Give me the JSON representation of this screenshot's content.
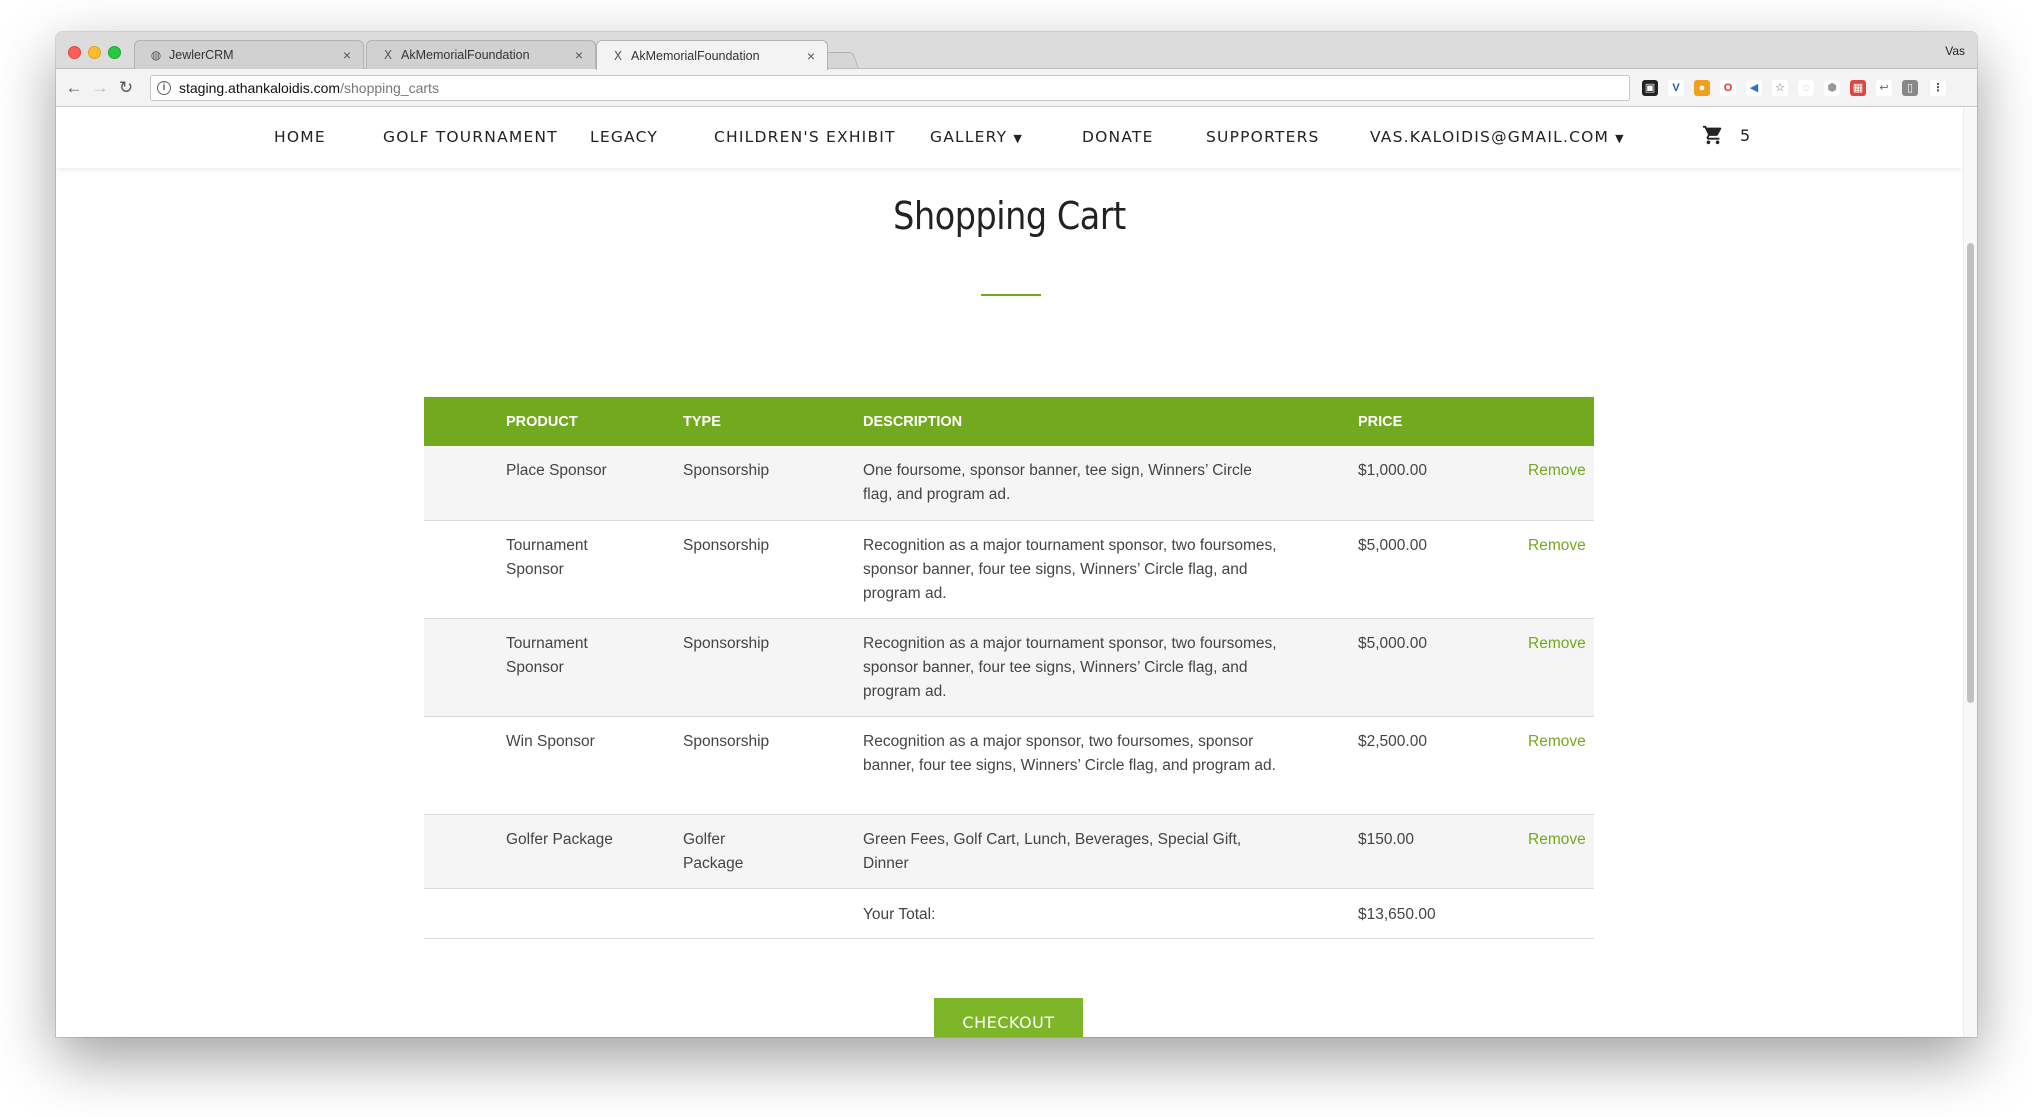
{
  "browser": {
    "tabs": [
      {
        "title": "JewlerCRM",
        "icon": "globe-icon",
        "active": false
      },
      {
        "title": "AkMemorialFoundation",
        "icon": "golf-clubs-icon",
        "active": false
      },
      {
        "title": "AkMemorialFoundation",
        "icon": "golf-clubs-icon",
        "active": true
      }
    ],
    "close_glyph": "×",
    "profile_name": "Vas",
    "url_host": "staging.athankaloidis.com",
    "url_path": "/shopping_carts",
    "colors": {
      "tabstrip": "#dcdcdc",
      "toolbar": "#f3f3f3"
    }
  },
  "site_nav": {
    "items": [
      {
        "label": "HOME",
        "has_dropdown": false
      },
      {
        "label": "GOLF TOURNAMENT",
        "has_dropdown": false
      },
      {
        "label": "LEGACY",
        "has_dropdown": false
      },
      {
        "label": "CHILDREN'S EXHIBIT",
        "has_dropdown": false
      },
      {
        "label": "GALLERY",
        "has_dropdown": true
      },
      {
        "label": "DONATE",
        "has_dropdown": false
      },
      {
        "label": "SUPPORTERS",
        "has_dropdown": false
      },
      {
        "label": "VAS.KALOIDIS@GMAIL.COM",
        "has_dropdown": true
      }
    ],
    "cart_icon": "shopping-cart-icon",
    "cart_count": "5"
  },
  "page": {
    "title": "Shopping Cart",
    "accent_color": "#72a91f"
  },
  "cart_table": {
    "headers": {
      "product": "PRODUCT",
      "type": "TYPE",
      "description": "DESCRIPTION",
      "price": "PRICE"
    },
    "rows": [
      {
        "product": "Place Sponsor",
        "type": "Sponsorship",
        "description": "One foursome, sponsor banner, tee sign, Winners’ Circle flag, and program ad.",
        "price": "$1,000.00",
        "action": "Remove"
      },
      {
        "product": "Tournament Sponsor",
        "type": "Sponsorship",
        "description": "Recognition as a major tournament sponsor, two foursomes, sponsor banner, four tee signs, Winners’ Circle flag, and program ad.",
        "price": "$5,000.00",
        "action": "Remove"
      },
      {
        "product": "Tournament Sponsor",
        "type": "Sponsorship",
        "description": "Recognition as a major tournament sponsor, two foursomes, sponsor banner, four tee signs, Winners’ Circle flag, and program ad.",
        "price": "$5,000.00",
        "action": "Remove"
      },
      {
        "product": "Win Sponsor",
        "type": "Sponsorship",
        "description": "Recognition as a major sponsor, two foursomes, sponsor banner, four tee signs, Winners’ Circle flag, and program ad.",
        "price": "$2,500.00",
        "action": "Remove"
      },
      {
        "product": "Golfer Package",
        "type": "Golfer Package",
        "description": "Green Fees, Golf Cart, Lunch, Beverages, Special Gift, Dinner",
        "price": "$150.00",
        "action": "Remove"
      }
    ],
    "total_label": "Your Total:",
    "total_value": "$13,650.00"
  },
  "checkout_label": "CHECKOUT"
}
